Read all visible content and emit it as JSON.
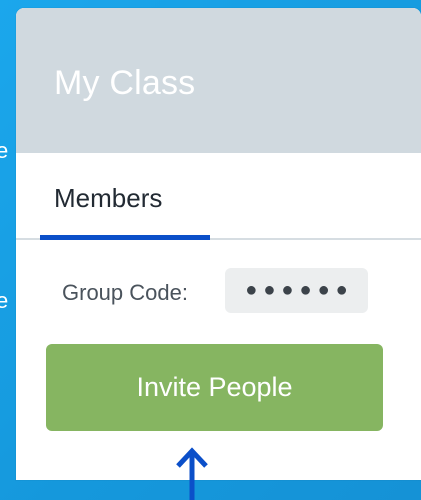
{
  "background": {
    "edge_chars": [
      "e",
      "e"
    ]
  },
  "card": {
    "title": "My Class",
    "tabs": [
      {
        "label": "Members",
        "active": true
      }
    ],
    "group_code": {
      "label": "Group Code:",
      "masked_value": "●●●●●●"
    },
    "invite_button": {
      "label": "Invite People"
    }
  },
  "colors": {
    "background": "#1aa3e8",
    "header": "#d0d9df",
    "tab_active_underline": "#0b4fc9",
    "invite_button": "#86b561",
    "arrow": "#0b4fc9"
  },
  "icons": {
    "pointer_arrow": "up-arrow-icon"
  }
}
